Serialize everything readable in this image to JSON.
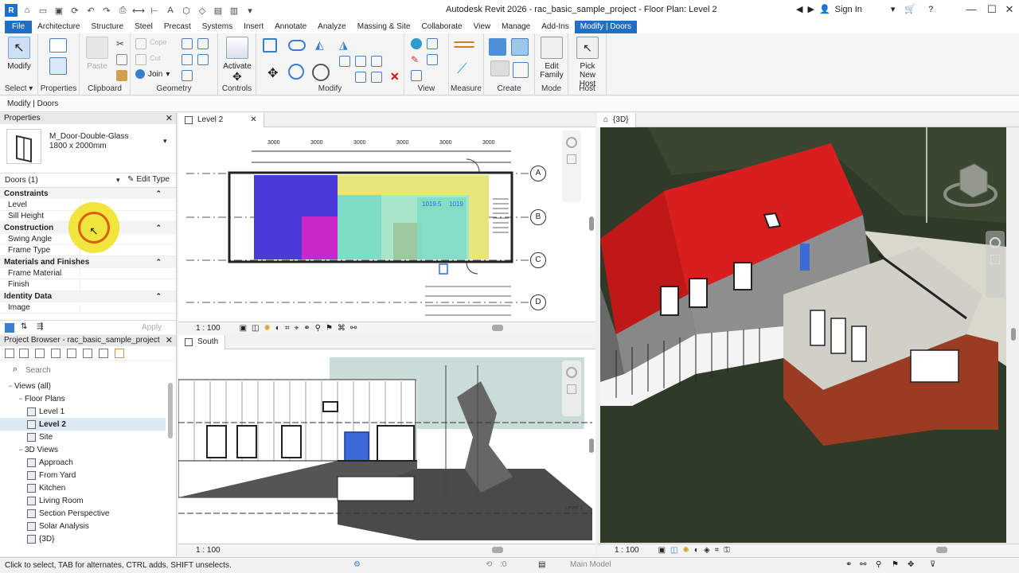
{
  "titlebar": {
    "title": "Autodesk Revit 2026 - rac_basic_sample_project - Floor Plan: Level 2",
    "sign_in": "Sign In"
  },
  "tabs": [
    "File",
    "Architecture",
    "Structure",
    "Steel",
    "Precast",
    "Systems",
    "Insert",
    "Annotate",
    "Analyze",
    "Massing & Site",
    "Collaborate",
    "View",
    "Manage",
    "Add-Ins",
    "Modify | Doors"
  ],
  "ribbon": {
    "modify_label": "Modify",
    "activate_label": "Activate",
    "join_label": "Join",
    "cut_label": "Cut",
    "paste_label": "Paste",
    "edit_family_label": "Edit Family",
    "pick_new_host_label": "Pick New Host",
    "panels": {
      "select": "Select",
      "properties": "Properties",
      "clipboard": "Clipboard",
      "geometry": "Geometry",
      "controls": "Controls",
      "modify": "Modify",
      "view": "View",
      "measure": "Measure",
      "create": "Create",
      "mode": "Mode",
      "host": "Host"
    }
  },
  "context_label": "Modify | Doors",
  "properties": {
    "header": "Properties",
    "type_name": "M_Door-Double-Glass",
    "type_size": "1800 x 2000mm",
    "instance_filter": "Doors (1)",
    "edit_type": "Edit Type",
    "groups": [
      {
        "name": "Constraints",
        "rows": [
          "Level",
          "Sill Height"
        ]
      },
      {
        "name": "Construction",
        "rows": [
          "Swing Angle",
          "Frame Type"
        ]
      },
      {
        "name": "Materials and Finishes",
        "rows": [
          "Frame Material",
          "Finish"
        ]
      },
      {
        "name": "Identity Data",
        "rows": [
          "Image"
        ]
      }
    ],
    "apply": "Apply"
  },
  "browser": {
    "header": "Project Browser - rac_basic_sample_project",
    "search_placeholder": "Search",
    "items": [
      {
        "label": "Views (all)",
        "level": 0,
        "toggle": "−"
      },
      {
        "label": "Floor Plans",
        "level": 1,
        "toggle": "−"
      },
      {
        "label": "Level 1",
        "level": 2
      },
      {
        "label": "Level 2",
        "level": 2,
        "selected": true
      },
      {
        "label": "Site",
        "level": 2
      },
      {
        "label": "3D Views",
        "level": 1,
        "toggle": "−"
      },
      {
        "label": "Approach",
        "level": 2
      },
      {
        "label": "From Yard",
        "level": 2
      },
      {
        "label": "Kitchen",
        "level": 2
      },
      {
        "label": "Living Room",
        "level": 2
      },
      {
        "label": "Section Perspective",
        "level": 2
      },
      {
        "label": "Solar Analysis",
        "level": 2
      },
      {
        "label": "{3D}",
        "level": 2
      }
    ]
  },
  "views": {
    "plan": {
      "tab": "Level 2",
      "scale": "1 : 100",
      "dims": [
        "3000",
        "3000",
        "3000",
        "3000",
        "3000",
        "3000"
      ],
      "grids": [
        "A",
        "B",
        "C",
        "D"
      ],
      "tags": [
        "1019.5",
        "1019"
      ]
    },
    "south": {
      "tab": "South",
      "scale": "1 : 100",
      "level_tag": "Level 1"
    },
    "three_d": {
      "tab": "{3D}",
      "scale": "1 : 100"
    }
  },
  "status": {
    "text": "Click to select, TAB for alternates, CTRL adds, SHIFT unselects.",
    "zero": ":0",
    "model": "Main Model"
  },
  "colors": {
    "accent": "#1f6fc5",
    "roof": "#d91e1e",
    "room_blue": "#4a3ad8",
    "room_yellow": "#e6e67a",
    "room_cyan": "#7fdcc7",
    "room_magenta": "#c828c8",
    "cladding": "#9a3b22",
    "highlight": "#f0e01c"
  }
}
